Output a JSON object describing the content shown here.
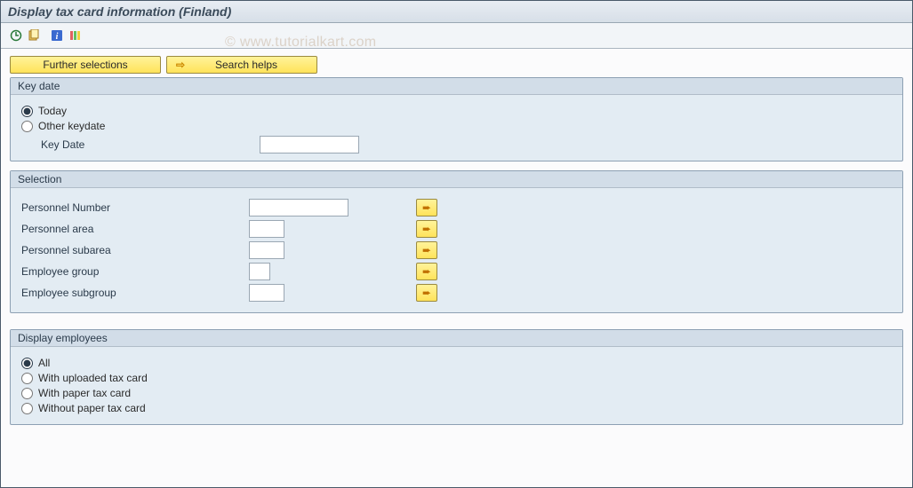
{
  "header": {
    "title": "Display tax card information (Finland)"
  },
  "watermark": "© www.tutorialkart.com",
  "toolbar": {
    "icons": [
      "execute",
      "get-variant",
      "info",
      "layout"
    ]
  },
  "buttons": {
    "further_selections": "Further selections",
    "search_helps": "Search helps"
  },
  "groups": {
    "key_date": {
      "title": "Key date",
      "radio_today": "Today",
      "radio_other": "Other keydate",
      "key_date_label": "Key Date",
      "key_date_value": ""
    },
    "selection": {
      "title": "Selection",
      "rows": [
        {
          "label": "Personnel Number",
          "width": "medium"
        },
        {
          "label": "Personnel area",
          "width": "short"
        },
        {
          "label": "Personnel subarea",
          "width": "short"
        },
        {
          "label": "Employee group",
          "width": "tiny"
        },
        {
          "label": "Employee subgroup",
          "width": "short"
        }
      ]
    },
    "display_employees": {
      "title": "Display employees",
      "opts": {
        "all": "All",
        "uploaded": "With uploaded tax card",
        "paper": "With paper tax card",
        "without": "Without paper tax card"
      }
    }
  }
}
